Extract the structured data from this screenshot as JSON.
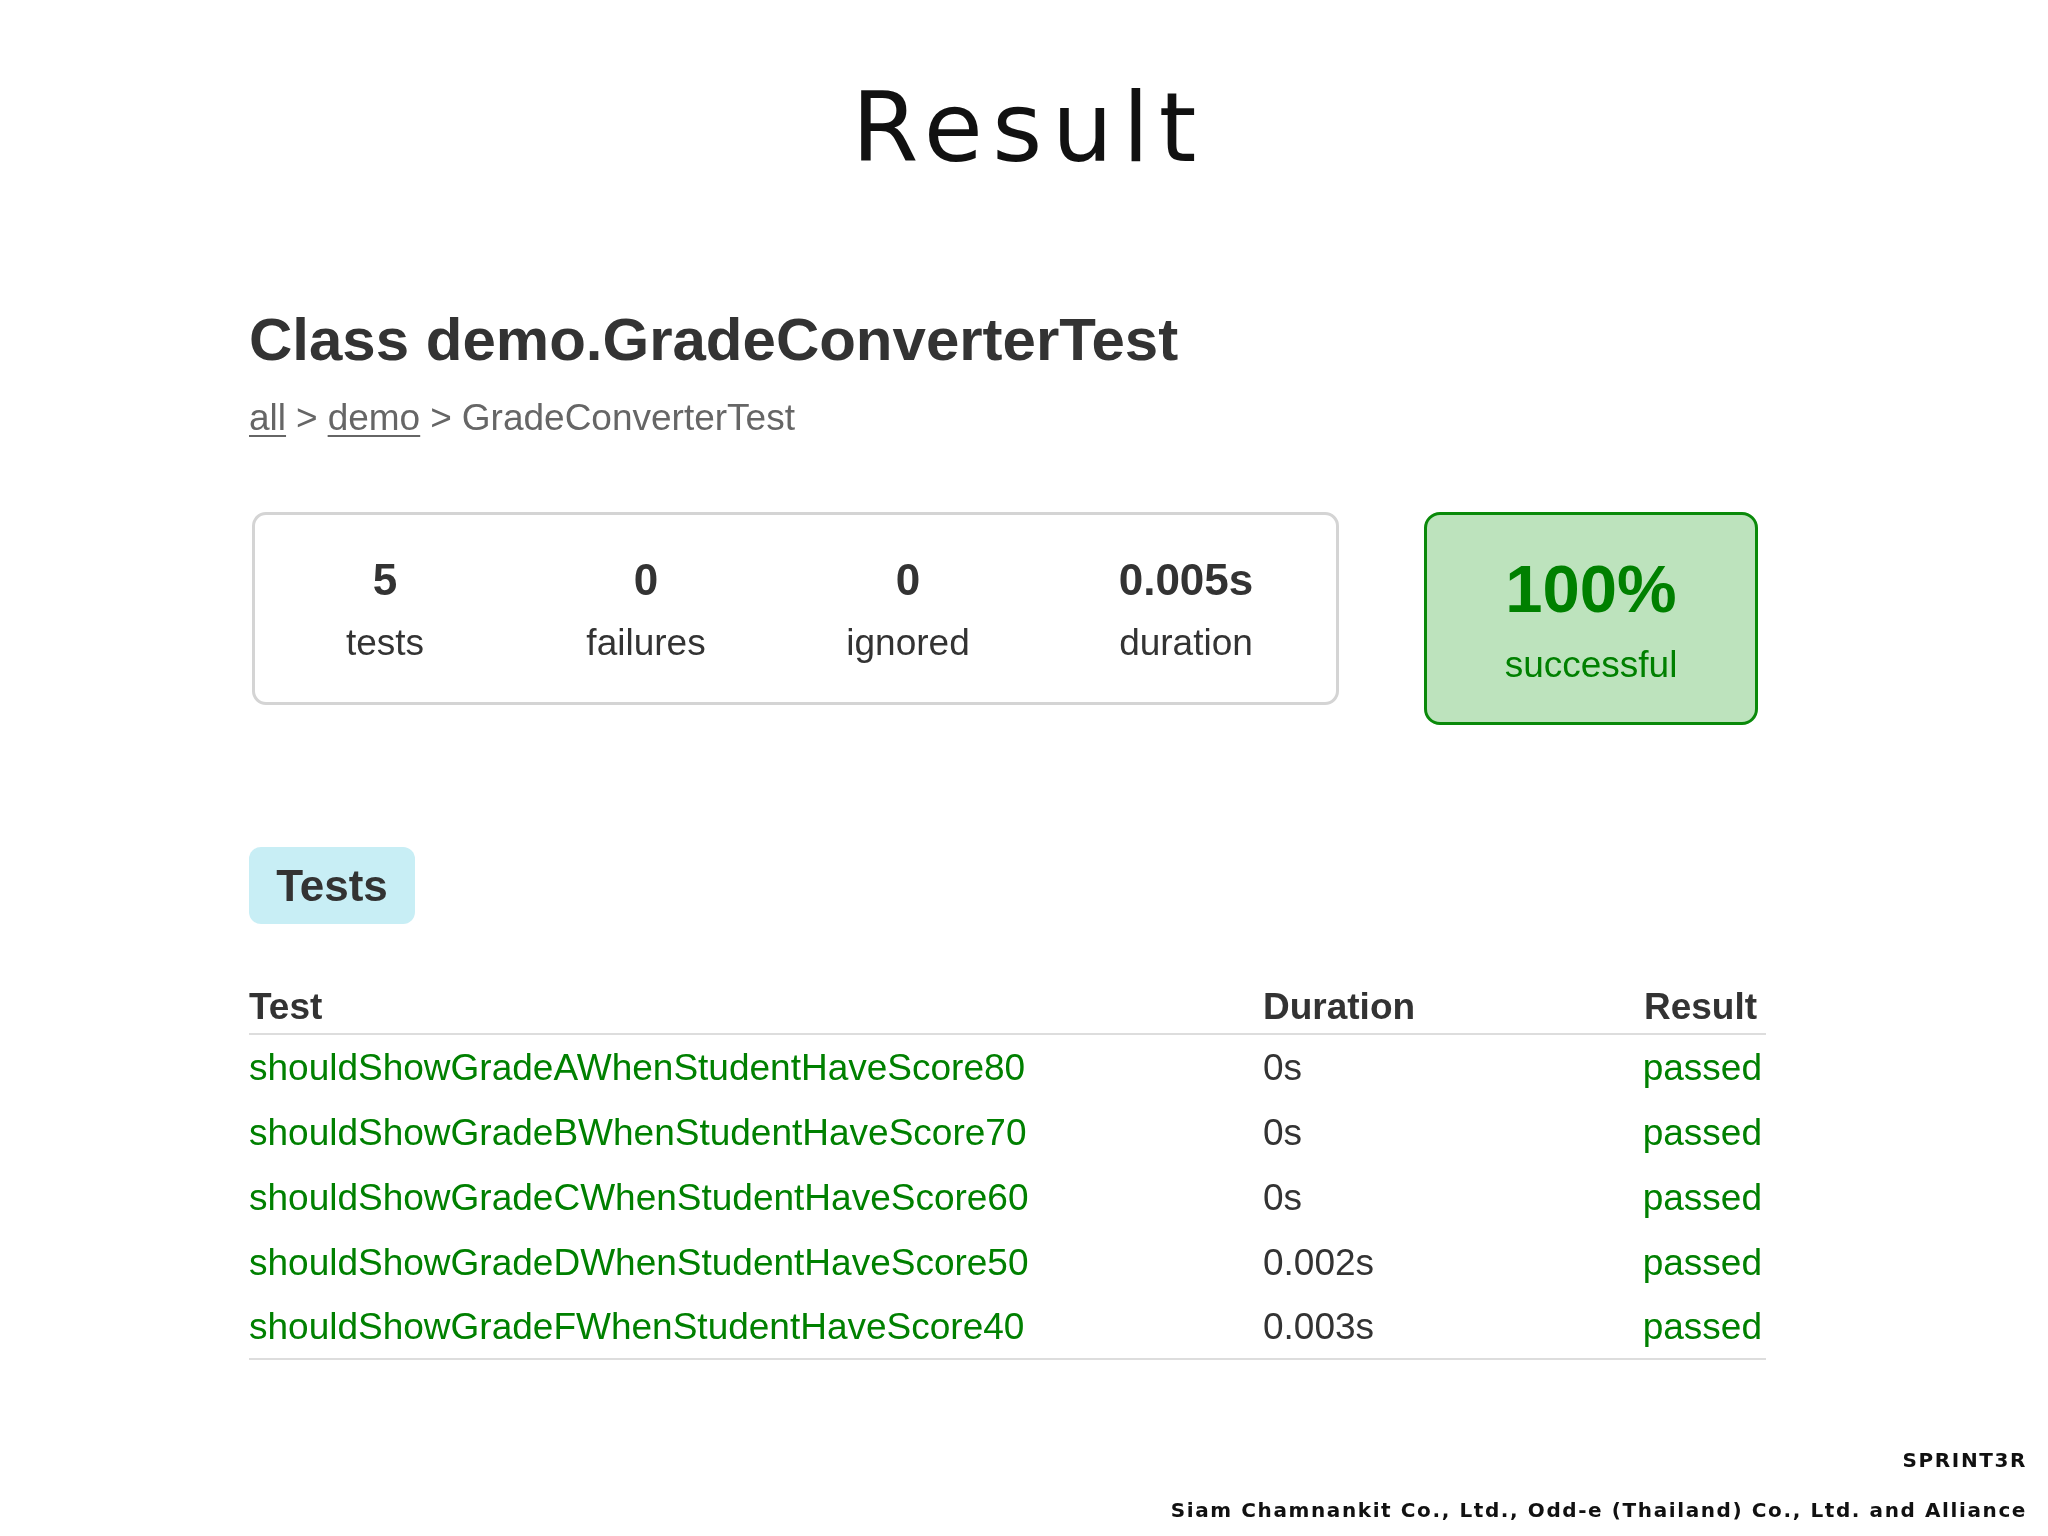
{
  "slide_title": "Result",
  "report": {
    "heading": "Class demo.GradeConverterTest",
    "breadcrumb": [
      {
        "kind": "link",
        "text": "all"
      },
      {
        "kind": "separator",
        "text": ">"
      },
      {
        "kind": "link",
        "text": "demo"
      },
      {
        "kind": "separator",
        "text": ">"
      },
      {
        "kind": "current",
        "text": "GradeConverterTest"
      }
    ],
    "summary": {
      "counters": [
        {
          "value": "5",
          "label": "tests"
        },
        {
          "value": "0",
          "label": "failures"
        },
        {
          "value": "0",
          "label": "ignored"
        },
        {
          "value": "0.005s",
          "label": "duration"
        }
      ],
      "success_rate": {
        "value": "100%",
        "label": "successful",
        "success": true
      }
    },
    "tabs": [
      {
        "label": "Tests",
        "selected": true
      }
    ],
    "table": {
      "columns": [
        "Test",
        "Duration",
        "Result"
      ],
      "rows": [
        {
          "test": "shouldShowGradeAWhenStudentHaveScore80",
          "duration": "0s",
          "result": "passed",
          "success": true
        },
        {
          "test": "shouldShowGradeBWhenStudentHaveScore70",
          "duration": "0s",
          "result": "passed",
          "success": true
        },
        {
          "test": "shouldShowGradeCWhenStudentHaveScore60",
          "duration": "0s",
          "result": "passed",
          "success": true
        },
        {
          "test": "shouldShowGradeDWhenStudentHaveScore50",
          "duration": "0.002s",
          "result": "passed",
          "success": true
        },
        {
          "test": "shouldShowGradeFWhenStudentHaveScore40",
          "duration": "0.003s",
          "result": "passed",
          "success": true
        }
      ]
    }
  },
  "footer": {
    "brand": "SPRINT3R",
    "credit": "Siam Chamnankit Co., Ltd., Odd-e (Thailand) Co., Ltd. and Alliance"
  }
}
